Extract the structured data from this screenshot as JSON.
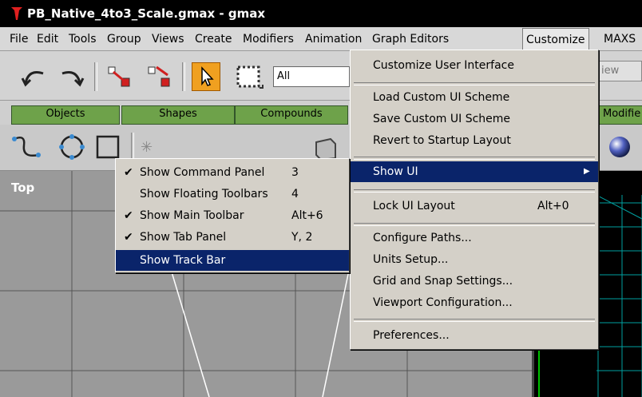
{
  "window": {
    "title": "PB_Native_4to3_Scale.gmax - gmax"
  },
  "menubar": [
    {
      "label": "File"
    },
    {
      "label": "Edit"
    },
    {
      "label": "Tools"
    },
    {
      "label": "Group"
    },
    {
      "label": "Views"
    },
    {
      "label": "Create"
    },
    {
      "label": "Modifiers"
    },
    {
      "label": "Animation"
    },
    {
      "label": "Graph Editors"
    },
    {
      "label": "Customize"
    },
    {
      "label": "MAXS"
    }
  ],
  "toolbar": {
    "selection_filter": "All",
    "view_dropdown": "iew"
  },
  "tabs": [
    {
      "label": "Objects"
    },
    {
      "label": "Shapes"
    },
    {
      "label": "Compounds"
    },
    {
      "label": "Modifie"
    }
  ],
  "viewport": {
    "label": "Top"
  },
  "customize_menu": {
    "items": [
      {
        "label": "Customize User Interface",
        "shortcut": ""
      },
      {
        "label": "Load Custom UI Scheme",
        "shortcut": ""
      },
      {
        "label": "Save Custom UI Scheme",
        "shortcut": ""
      },
      {
        "label": "Revert to Startup Layout",
        "shortcut": ""
      },
      {
        "label": "Show UI",
        "shortcut": "",
        "arrow": "▶"
      },
      {
        "label": "Lock UI Layout",
        "shortcut": "Alt+0"
      },
      {
        "label": "Configure Paths...",
        "shortcut": ""
      },
      {
        "label": "Units Setup...",
        "shortcut": ""
      },
      {
        "label": "Grid and Snap Settings...",
        "shortcut": ""
      },
      {
        "label": "Viewport Configuration...",
        "shortcut": ""
      },
      {
        "label": "Preferences...",
        "shortcut": ""
      }
    ]
  },
  "show_ui_submenu": {
    "items": [
      {
        "label": "Show Command Panel",
        "shortcut": "3",
        "checked": "✔"
      },
      {
        "label": "Show Floating Toolbars",
        "shortcut": "4",
        "checked": ""
      },
      {
        "label": "Show Main Toolbar",
        "shortcut": "Alt+6",
        "checked": "✔"
      },
      {
        "label": "Show Tab Panel",
        "shortcut": "Y, 2",
        "checked": "✔"
      },
      {
        "label": "Show Track Bar",
        "shortcut": "",
        "checked": ""
      }
    ]
  },
  "colors": {
    "highlight": "#0a246a",
    "tab_green": "#6ea24a",
    "select_tool": "#f0a020",
    "grid_cyan": "#00a0a0"
  }
}
